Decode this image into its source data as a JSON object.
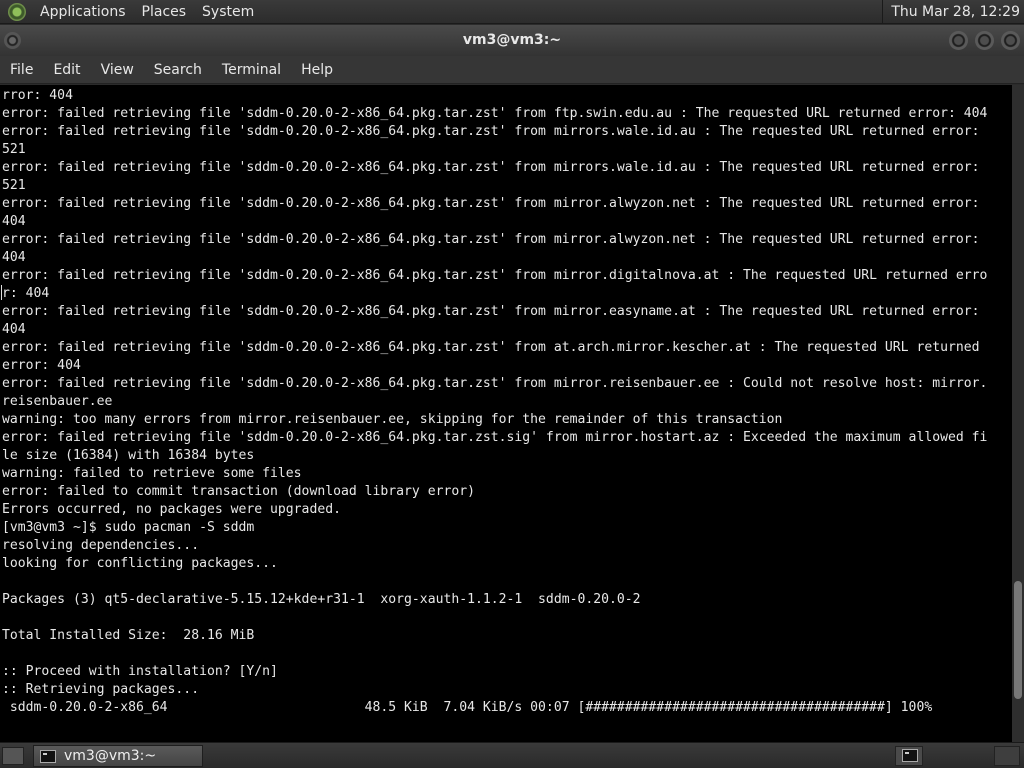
{
  "top_panel": {
    "menus": [
      "Applications",
      "Places",
      "System"
    ],
    "clock": "Thu Mar 28, 12:29"
  },
  "window": {
    "title": "vm3@vm3:~"
  },
  "menubar": [
    "File",
    "Edit",
    "View",
    "Search",
    "Terminal",
    "Help"
  ],
  "terminal": {
    "lines": [
      "rror: 404",
      "error: failed retrieving file 'sddm-0.20.0-2-x86_64.pkg.tar.zst' from ftp.swin.edu.au : The requested URL returned error: 404",
      "error: failed retrieving file 'sddm-0.20.0-2-x86_64.pkg.tar.zst' from mirrors.wale.id.au : The requested URL returned error:",
      "521",
      "error: failed retrieving file 'sddm-0.20.0-2-x86_64.pkg.tar.zst' from mirrors.wale.id.au : The requested URL returned error:",
      "521",
      "error: failed retrieving file 'sddm-0.20.0-2-x86_64.pkg.tar.zst' from mirror.alwyzon.net : The requested URL returned error:",
      "404",
      "error: failed retrieving file 'sddm-0.20.0-2-x86_64.pkg.tar.zst' from mirror.alwyzon.net : The requested URL returned error:",
      "404",
      "error: failed retrieving file 'sddm-0.20.0-2-x86_64.pkg.tar.zst' from mirror.digitalnova.at : The requested URL returned erro",
      "r: 404",
      "error: failed retrieving file 'sddm-0.20.0-2-x86_64.pkg.tar.zst' from mirror.easyname.at : The requested URL returned error:",
      "404",
      "error: failed retrieving file 'sddm-0.20.0-2-x86_64.pkg.tar.zst' from at.arch.mirror.kescher.at : The requested URL returned",
      "error: 404",
      "error: failed retrieving file 'sddm-0.20.0-2-x86_64.pkg.tar.zst' from mirror.reisenbauer.ee : Could not resolve host: mirror.",
      "reisenbauer.ee",
      "warning: too many errors from mirror.reisenbauer.ee, skipping for the remainder of this transaction",
      "error: failed retrieving file 'sddm-0.20.0-2-x86_64.pkg.tar.zst.sig' from mirror.hostart.az : Exceeded the maximum allowed fi",
      "le size (16384) with 16384 bytes",
      "warning: failed to retrieve some files",
      "error: failed to commit transaction (download library error)",
      "Errors occurred, no packages were upgraded.",
      "[vm3@vm3 ~]$ sudo pacman -S sddm",
      "resolving dependencies...",
      "looking for conflicting packages...",
      "",
      "Packages (3) qt5-declarative-5.15.12+kde+r31-1  xorg-xauth-1.1.2-1  sddm-0.20.0-2",
      "",
      "Total Installed Size:  28.16 MiB",
      "",
      ":: Proceed with installation? [Y/n]",
      ":: Retrieving packages...",
      " sddm-0.20.0-2-x86_64                         48.5 KiB  7.04 KiB/s 00:07 [######################################] 100%"
    ],
    "scroll_position": 0.92
  },
  "taskbar": {
    "task_label": "vm3@vm3:~"
  }
}
